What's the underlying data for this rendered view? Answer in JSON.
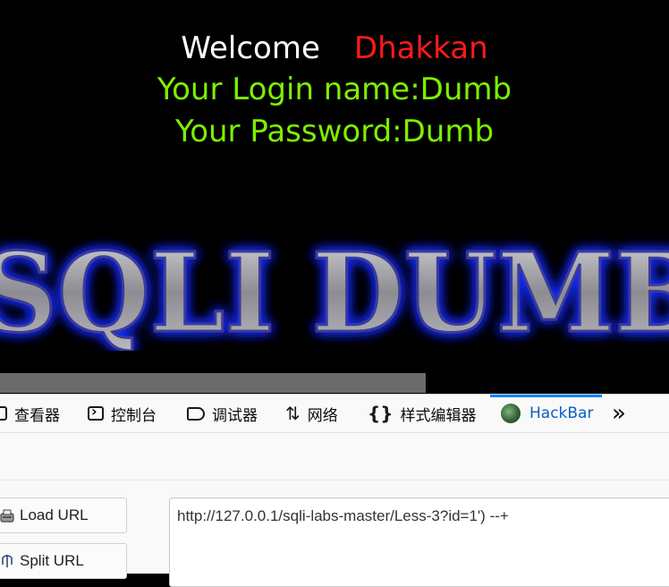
{
  "page": {
    "welcome": "Welcome",
    "username_display": "Dhakkan",
    "login_line": "Your Login name:Dumb",
    "password_line": "Your Password:Dumb",
    "banner_text": "SQLI DUMB",
    "colors": {
      "background": "#000000",
      "welcome": "#ffffff",
      "username": "#ff1a1a",
      "info": "#7cf000",
      "banner_glow": "#1a2cff"
    }
  },
  "devtools": {
    "tabs": [
      {
        "label": "查看器",
        "icon": "inspector-icon"
      },
      {
        "label": "控制台",
        "icon": "console-icon"
      },
      {
        "label": "调试器",
        "icon": "debugger-icon"
      },
      {
        "label": "网络",
        "icon": "network-icon"
      },
      {
        "label": "样式编辑器",
        "icon": "style-editor-icon"
      },
      {
        "label": "HackBar",
        "icon": "hackbar-icon",
        "active": true
      }
    ],
    "overflow_icon": "chevrons-right-icon",
    "hackbar": {
      "load_url_label": "Load URL",
      "split_url_label": "Split URL",
      "url_value": "http://127.0.0.1/sqli-labs-master/Less-3?id=1') --+"
    },
    "accent_color": "#0a84ff"
  }
}
